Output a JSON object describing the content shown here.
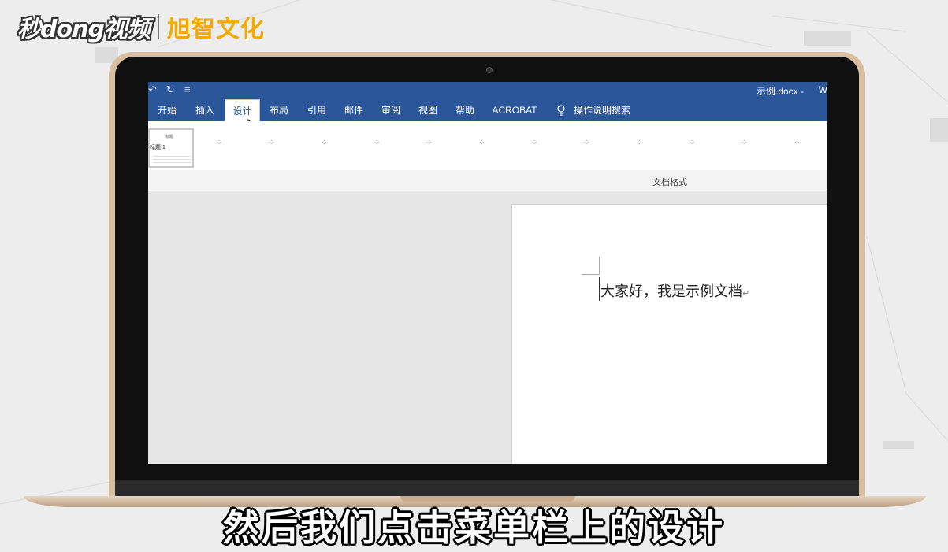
{
  "brand": {
    "left_logo": "秒dong视频",
    "right_logo": "旭智文化"
  },
  "word": {
    "quick_access": [
      "↶",
      "↻",
      "≡"
    ],
    "doc_title": "示例.docx -",
    "doc_title_tail": "W",
    "tabs": [
      {
        "label": "开始",
        "active": false
      },
      {
        "label": "插入",
        "active": false
      },
      {
        "label": "设计",
        "active": true
      },
      {
        "label": "布局",
        "active": false
      },
      {
        "label": "引用",
        "active": false
      },
      {
        "label": "邮件",
        "active": false
      },
      {
        "label": "审阅",
        "active": false
      },
      {
        "label": "视图",
        "active": false
      },
      {
        "label": "帮助",
        "active": false
      },
      {
        "label": "ACROBAT",
        "active": false
      }
    ],
    "tell_me": "操作说明搜索",
    "style_thumb": {
      "small": "标题",
      "label": "标题 1"
    },
    "group_label": "文档格式",
    "document_text": "大家好，我是示例文档",
    "para_mark": "↵"
  },
  "caption": "然后我们点击菜单栏上的设计",
  "colors": {
    "ribbon_blue": "#2b579a",
    "logo_gold": "#f2a900"
  }
}
